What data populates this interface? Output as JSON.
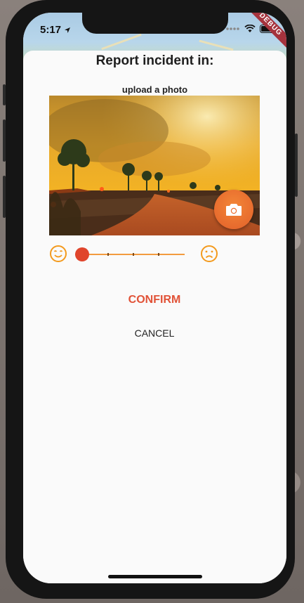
{
  "status_bar": {
    "time": "5:17",
    "debug_label": "DEBUG"
  },
  "dialog": {
    "title": "Report incident in:",
    "subtitle": "upload a photo",
    "photo_alt": "bushfire photo",
    "camera_button": "camera-icon",
    "slider": {
      "value": 0,
      "min": 0,
      "max": 4,
      "divisions": 4
    },
    "left_face": "smiling-face-icon",
    "right_face": "frowning-face-icon",
    "confirm_label": "CONFIRM",
    "cancel_label": "CANCEL"
  },
  "colors": {
    "accent": "#e15237",
    "fab": "#ef7a34",
    "emoji": "#f39a1d",
    "sheet": "#fafafa"
  }
}
